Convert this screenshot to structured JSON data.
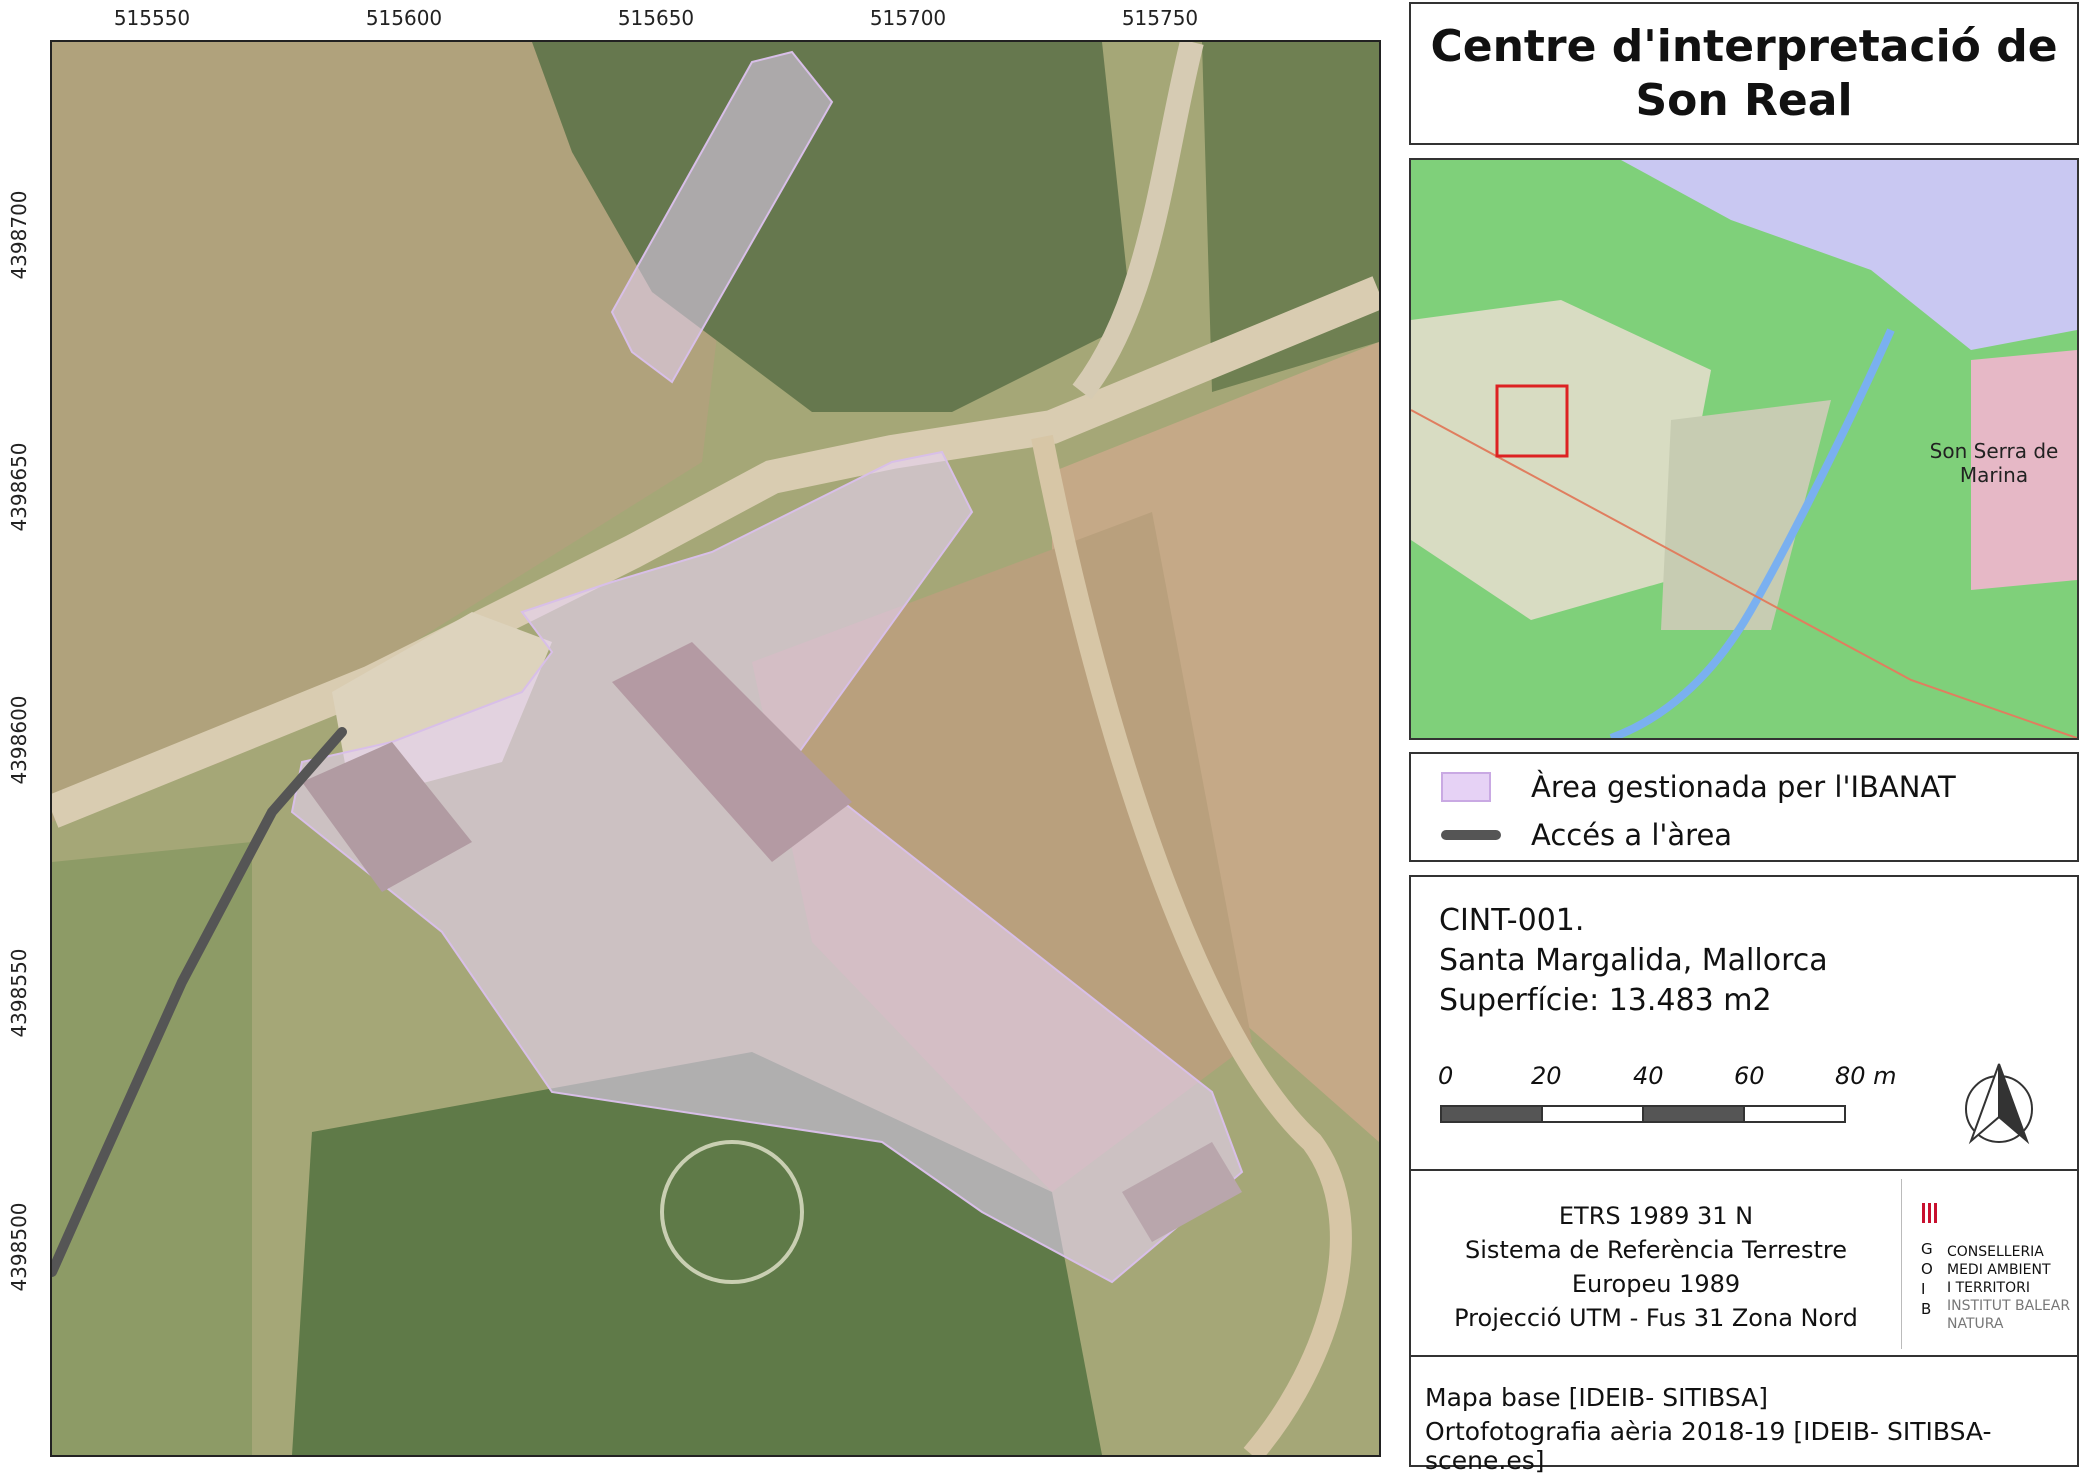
{
  "map": {
    "x_ticks": [
      "515550",
      "515600",
      "515650",
      "515700",
      "515750"
    ],
    "y_ticks": [
      "4398700",
      "4398650",
      "4398600",
      "4398550",
      "4398500"
    ]
  },
  "title": "Centre d'interpretació de Son Real",
  "inset": {
    "place_label_line1": "Son Serra de",
    "place_label_line2": "Marina",
    "colors": {
      "land": "#7fd07a",
      "sea": "#c9c8f2",
      "highlight": "#dd2222"
    }
  },
  "legend": {
    "items": [
      {
        "label": "Àrea gestionada per l'IBANAT",
        "color": "#e6d2f5"
      },
      {
        "label": "Accés a l'àrea",
        "color": "#555555"
      }
    ]
  },
  "info": {
    "code": "CINT-001.",
    "location": "Santa Margalida, Mallorca",
    "area": "Superfície: 13.483 m2"
  },
  "scale": {
    "labels": [
      "0",
      "20",
      "40",
      "60",
      "80 m"
    ]
  },
  "crs": {
    "lines": [
      "ETRS 1989 31 N",
      "Sistema de Referència Terrestre",
      "Europeu 1989",
      "Projecció UTM - Fus 31 Zona Nord"
    ]
  },
  "logo": {
    "letters": [
      "G",
      "O",
      "I",
      "B"
    ],
    "lines": [
      "CONSELLERIA",
      "MEDI AMBIENT",
      "I TERRITORI",
      "INSTITUT BALEAR",
      "NATURA"
    ]
  },
  "source": {
    "line1": "Mapa base [IDEIB- SITIBSA]",
    "line2": "Ortofotografia aèria 2018-19 [IDEIB- SITIBSA-scene.es]"
  }
}
